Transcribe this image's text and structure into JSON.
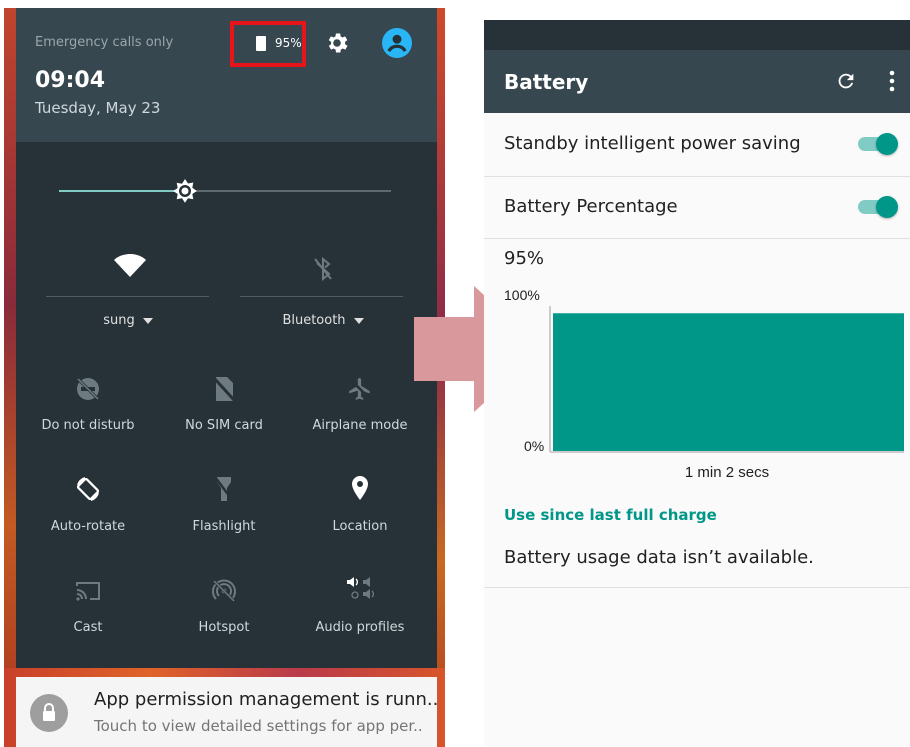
{
  "left": {
    "status": {
      "emergency_text": "Emergency calls only",
      "time": "09:04",
      "date": "Tuesday, May 23",
      "battery_percent": "95%",
      "highlight_color": "#e8141c"
    },
    "brightness": {
      "level": 0.38
    },
    "network_tiles": [
      {
        "label": "sung",
        "icon": "wifi-icon"
      },
      {
        "label": "Bluetooth",
        "icon": "bluetooth-off-icon"
      }
    ],
    "tiles": [
      {
        "label": "Do not disturb",
        "icon": "do-not-disturb-icon"
      },
      {
        "label": "No SIM card",
        "icon": "no-sim-icon"
      },
      {
        "label": "Airplane mode",
        "icon": "airplane-icon"
      },
      {
        "label": "Auto-rotate",
        "icon": "auto-rotate-icon"
      },
      {
        "label": "Flashlight",
        "icon": "flashlight-icon"
      },
      {
        "label": "Location",
        "icon": "location-icon"
      },
      {
        "label": "Cast",
        "icon": "cast-icon"
      },
      {
        "label": "Hotspot",
        "icon": "hotspot-icon"
      },
      {
        "label": "Audio profiles",
        "icon": "audio-profiles-icon"
      }
    ],
    "notification": {
      "title": "App permission management is runn..",
      "body": "Touch to view detailed settings for app per..",
      "icon": "lock-icon"
    }
  },
  "right": {
    "toolbar_title": "Battery",
    "prefs": [
      {
        "label": "Standby intelligent power saving",
        "enabled": true
      },
      {
        "label": "Battery Percentage",
        "enabled": true
      }
    ],
    "battery_level": "95%",
    "chart_data": {
      "type": "area",
      "y_top_label": "100%",
      "y_bottom_label": "0%",
      "x_label": "1 min 2 secs",
      "ylim": [
        0,
        100
      ],
      "values": [
        95,
        95
      ],
      "fill_color": "#009688"
    },
    "section_header": "Use since last full charge",
    "usage_text": "Battery usage data isn’t available.",
    "accent_color": "#009688"
  }
}
